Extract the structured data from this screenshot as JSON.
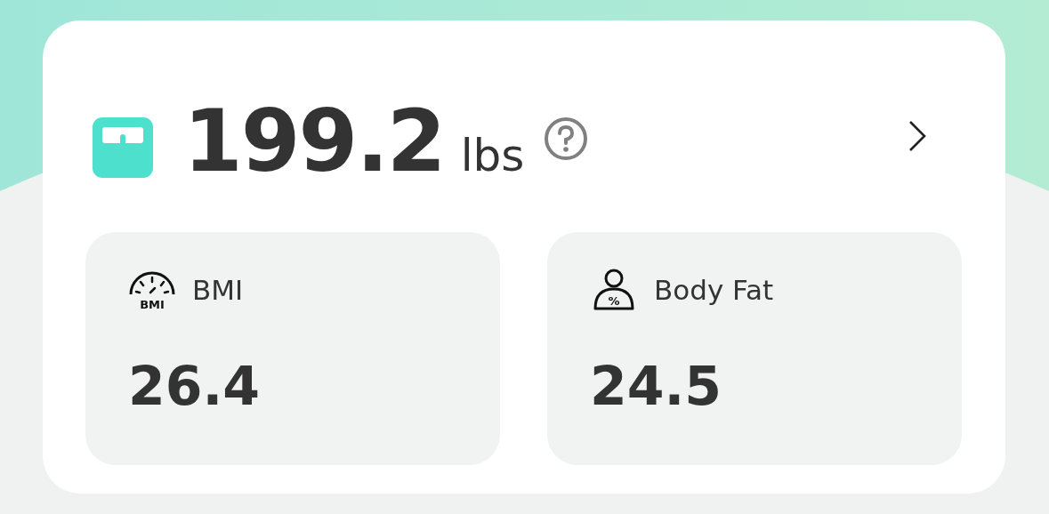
{
  "weight": {
    "value": "199.2",
    "unit": "lbs"
  },
  "metrics": [
    {
      "kind": "gauge",
      "icon_label": "BMI",
      "label": "BMI",
      "value": "26.4"
    },
    {
      "kind": "person",
      "icon_label": "%",
      "label": "Body Fat",
      "value": "24.5"
    }
  ]
}
